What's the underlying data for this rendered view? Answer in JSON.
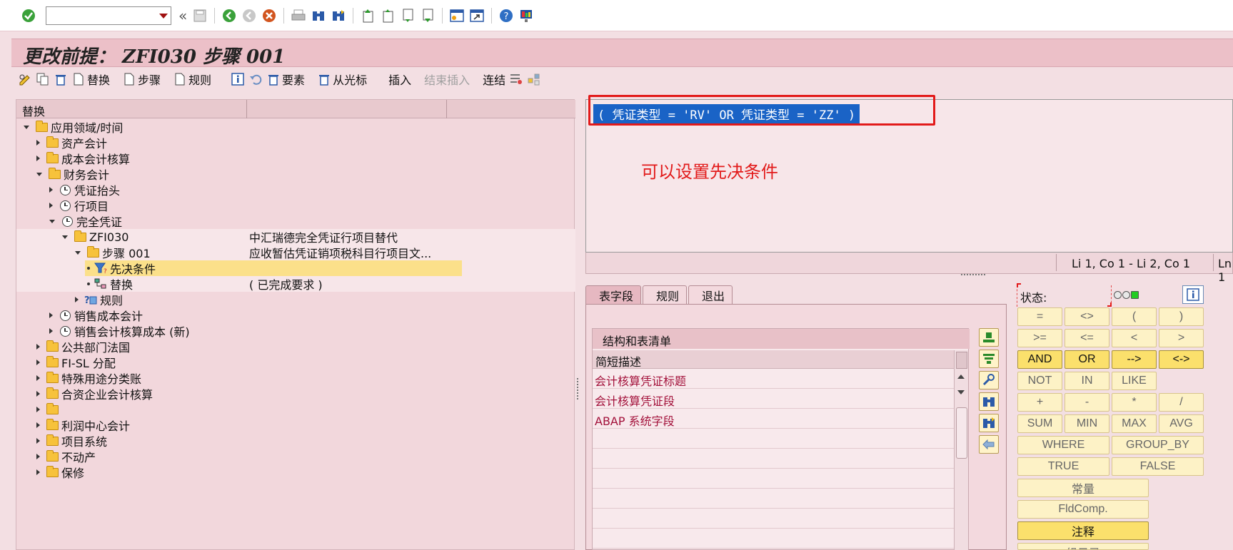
{
  "page_title": "更改前提： ZFI030 步骤 001",
  "app_toolbar": {
    "replace": "替换",
    "step": "步骤",
    "rule": "规则",
    "element": "要素",
    "from_cursor": "从光标",
    "insert": "插入",
    "end_insert": "结束插入",
    "link": "连结"
  },
  "tree": {
    "header": "替换",
    "rows": [
      {
        "label": "应用领域/时间",
        "desc": ""
      },
      {
        "label": "资产会计",
        "desc": ""
      },
      {
        "label": "成本会计核算",
        "desc": ""
      },
      {
        "label": "财务会计",
        "desc": ""
      },
      {
        "label": "凭证抬头",
        "desc": ""
      },
      {
        "label": "行项目",
        "desc": ""
      },
      {
        "label": "完全凭证",
        "desc": ""
      },
      {
        "label": "ZFI030",
        "desc": "中汇瑞德完全凭证行项目替代"
      },
      {
        "label": "步骤 001",
        "desc": "应收暂估凭证销项税科目行项目文..."
      },
      {
        "label": "先决条件",
        "desc": ""
      },
      {
        "label": "替换",
        "desc": "( 已完成要求 )"
      },
      {
        "label": "规则",
        "desc": ""
      },
      {
        "label": "销售成本会计",
        "desc": ""
      },
      {
        "label": "销售会计核算成本 (新)",
        "desc": ""
      },
      {
        "label": "公共部门法国",
        "desc": ""
      },
      {
        "label": "FI-SL 分配",
        "desc": ""
      },
      {
        "label": "特殊用途分类账",
        "desc": ""
      },
      {
        "label": "合资企业会计核算",
        "desc": ""
      },
      {
        "label": "",
        "desc": ""
      },
      {
        "label": "利润中心会计",
        "desc": ""
      },
      {
        "label": "项目系统",
        "desc": ""
      },
      {
        "label": "不动产",
        "desc": ""
      },
      {
        "label": "保修",
        "desc": ""
      }
    ]
  },
  "editor": {
    "condition": "( 凭证类型 = 'RV' OR 凭证类型 = 'ZZ' )",
    "annotation": "可以设置先决条件",
    "position": "Li 1, Co 1 - Li 2, Co 1",
    "line_prefix": "Ln 1"
  },
  "tabs": [
    "表字段",
    "规则",
    "退出"
  ],
  "structure": {
    "title": "结构和表清单",
    "column": "简短描述",
    "rows": [
      "会计核算凭证标题",
      "会计核算凭证段",
      "ABAP 系统字段"
    ]
  },
  "status_label": "状态:",
  "operators": {
    "eq": "=",
    "ne": "<>",
    "lp": "(",
    "rp": ")",
    "ge": ">=",
    "le": "<=",
    "lt": "<",
    "gt": ">",
    "and": "AND",
    "or": "OR",
    "imp": "-->",
    "eqv": "<->",
    "not": "NOT",
    "in": "IN",
    "like": "LIKE",
    "plus": "+",
    "minus": "-",
    "mul": "*",
    "div": "/",
    "sum": "SUM",
    "min": "MIN",
    "max": "MAX",
    "avg": "AVG",
    "where": "WHERE",
    "group_by": "GROUP_BY",
    "true": "TRUE",
    "false": "FALSE",
    "constant": "常量",
    "fldcomp": "FldComp.",
    "comment": "注释",
    "cut": "组日录"
  },
  "colors": {
    "title_bg": "#ecc0c8",
    "selection": "#1a63c6",
    "annotation": "#e21a1a",
    "tree_selected": "#fbe08a"
  }
}
